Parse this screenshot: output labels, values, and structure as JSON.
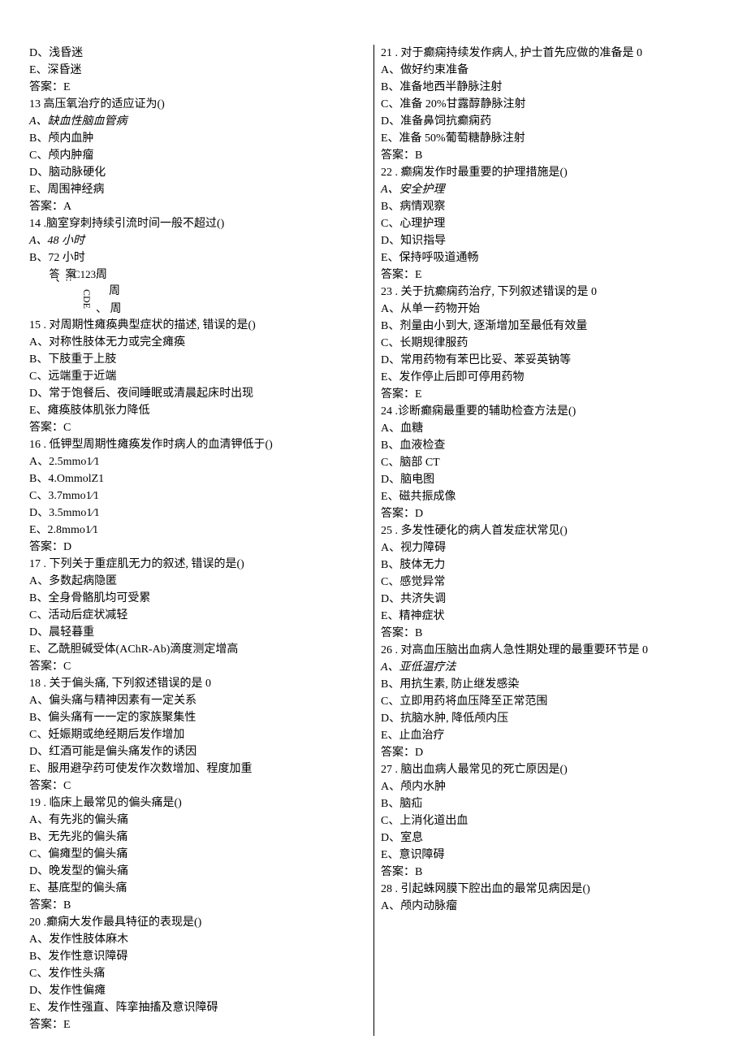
{
  "leftColumn": {
    "pre": [
      "D、浅昏迷",
      "E、深昏迷",
      "答案：E"
    ],
    "q13": {
      "stem": "13 高压氧治疗的适应证为()",
      "opts": [
        "A、缺血性脑血管病",
        "B、颅内血肿",
        "C、颅内肿瘤",
        "D、脑动脉硬化",
        "E、周围神经病"
      ],
      "ans": "答案：A"
    },
    "q14": {
      "stem": "14   .脑室穿刺持续引流时间一般不超过()",
      "opts": [
        "A、48 小时",
        "B、72 小时"
      ],
      "weird": {
        "v1": "答、",
        "v2": "案:",
        "v3": "C123:",
        "v4": "周",
        "v5": "周",
        "v6": "、 周",
        "cde": "CDE"
      }
    },
    "q15": {
      "stem": "15   . 对周期性瘫痪典型症状的描述, 错误的是()",
      "opts": [
        "A、对称性肢体无力或完全瘫痪",
        "B、下肢重于上肢",
        "C、远端重于近端",
        "D、常于饱餐后、夜间睡眠或清晨起床时出现",
        "E、瘫痪肢体肌张力降低"
      ],
      "ans": "答案：C"
    },
    "q16": {
      "stem": "16   . 低钾型周期性瘫痪发作时病人的血清钾低于()",
      "opts": [
        "A、2.5mmo1∕1",
        "B、4.OmmolZ1",
        "C、3.7mmo1∕1",
        "D、3.5mmo1∕1",
        "E、2.8mmo1∕1"
      ],
      "ans": "答案：D"
    },
    "q17": {
      "stem": "17   . 下列关于重症肌无力的叙述, 错误的是()",
      "opts": [
        "A、多数起病隐匿",
        "B、全身骨骼肌均可受累",
        "C、活动后症状减轻",
        "D、晨轻暮重",
        "E、乙酰胆碱受体(AChR-Ab)滴度测定增高"
      ],
      "ans": "答案：C"
    },
    "q18": {
      "stem": "18   . 关于偏头痛, 下列叙述错误的是 0",
      "opts": [
        "A、偏头痛与精神因素有一定关系",
        "B、偏头痛有一一定的家族聚集性",
        "C、妊娠期或绝经期后发作增加",
        "D、红酒可能是偏头痛发作的诱因",
        "E、服用避孕药可使发作次数增加、程度加重"
      ],
      "ans": "答案：C"
    },
    "q19": {
      "stem": "19   . 临床上最常见的偏头痛是()",
      "opts": [
        "A、有先兆的偏头痛",
        "B、无先兆的偏头痛",
        "C、偏瘫型的偏头痛",
        "D、晚发型的偏头痛",
        "E、基底型的偏头痛"
      ],
      "ans": "答案：B"
    },
    "q20": {
      "stem": "20   .癫痫大发作最具特征的表现是()",
      "opts": [
        "A、发作性肢体麻木",
        "B、发作性意识障碍",
        "C、发作性头痛",
        "D、发作性偏瘫",
        "E、发作性强直、阵挛抽搐及意识障碍"
      ]
    }
  },
  "rightColumn": {
    "pre": [
      "答案：E"
    ],
    "q21": {
      "stem": "21   . 对于癫痫持续发作病人, 护士首先应做的准备是 0",
      "opts": [
        "A、做好约束准备",
        "B、准备地西半静脉注射",
        "C、准备 20%甘露醇静脉注射",
        "D、准备鼻饲抗癫痫药",
        "E、准备 50%葡萄糖静脉注射"
      ],
      "ans": "答案：B"
    },
    "q22": {
      "stem": "22   . 癫痫发作时最重要的护理措施是()",
      "opts": [
        "A、安全护理",
        "B、病情观察",
        "C、心理护理",
        "D、知识指导",
        "E、保持呼吸道通畅"
      ],
      "ans": "答案：E"
    },
    "q23": {
      "stem": "23   . 关于抗癫痫药治疗, 下列叙述错误的是 0",
      "opts": [
        "A、从单一药物开始",
        "B、剂量由小到大, 逐渐增加至最低有效量",
        "C、长期规律服药",
        "D、常用药物有苯巴比妥、苯妥英钠等",
        "E、发作停止后即可停用药物"
      ],
      "ans": "答案：E"
    },
    "q24": {
      "stem": "24   .诊断癫痫最重要的辅助检查方法是()",
      "opts": [
        "A、血糖",
        "B、血液检查",
        "C、脑部 CT",
        "D、脑电图",
        "E、磁共振成像"
      ],
      "ans": "答案：D"
    },
    "q25": {
      "stem": "25   . 多发性硬化的病人首发症状常见()",
      "opts": [
        "A、视力障碍",
        "B、肢体无力",
        "C、感觉异常",
        "D、共济失调",
        "E、精神症状"
      ],
      "ans": "答案：B"
    },
    "q26": {
      "stem": "26   . 对高血压脑出血病人急性期处理的最重要环节是 0",
      "opts": [
        "A、亚低温疗法",
        "B、用抗生素, 防止继发感染",
        "C、立即用药将血压降至正常范围",
        "D、抗脑水肿, 降低颅内压",
        "E、止血治疗"
      ],
      "ans": "答案：D"
    },
    "q27": {
      "stem": "27   . 脑出血病人最常见的死亡原因是()",
      "opts": [
        "A、颅内水肿",
        "B、脑疝",
        "C、上消化道出血",
        "D、室息",
        "E、意识障碍"
      ],
      "ans": "答案：B"
    },
    "q28": {
      "stem": "28   . 引起蛛网膜下腔出血的最常见病因是()",
      "opts": [
        "A、颅内动脉瘤"
      ]
    }
  }
}
